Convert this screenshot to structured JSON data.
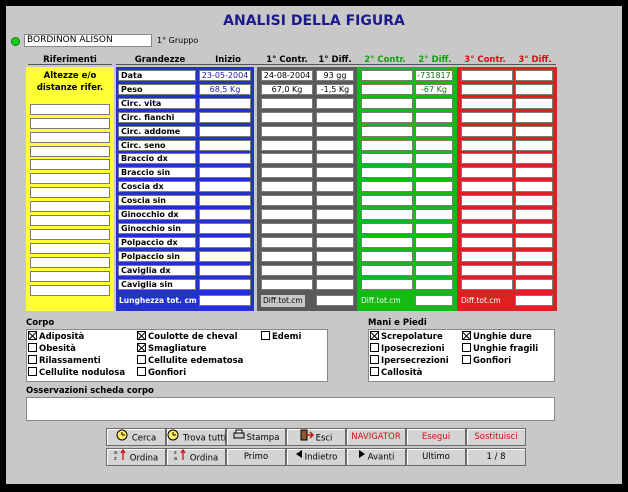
{
  "header": {
    "title": "ANALISI DELLA FIGURA",
    "patient_name": "BORDINON ALISON",
    "group": "1° Gruppo"
  },
  "columns": {
    "riferimenti": "Riferimenti",
    "grandezze": "Grandezze",
    "inizio": "Inizio",
    "contr1": "1° Contr.",
    "diff1": "1° Diff.",
    "contr2": "2° Contr.",
    "diff2": "2° Diff.",
    "contr3": "3° Contr.",
    "diff3": "3° Diff."
  },
  "riferimenti_label": "Altezze e/o distanze rifer.",
  "rows": [
    {
      "label": "Data",
      "inizio": "23-05-2004",
      "contr1": "24-08-2004",
      "diff1": "93 gg",
      "contr2": "",
      "diff2": "-731817",
      "contr3": "",
      "diff3": ""
    },
    {
      "label": "Peso",
      "inizio": "68,5 Kg",
      "contr1": "67,0 Kg",
      "diff1": "-1,5 Kg",
      "contr2": "",
      "diff2": "-67 Kg",
      "contr3": "",
      "diff3": ""
    },
    {
      "label": "Circ. vita"
    },
    {
      "label": "Circ. fianchi"
    },
    {
      "label": "Circ. addome"
    },
    {
      "label": "Circ. seno"
    },
    {
      "label": "Braccio dx"
    },
    {
      "label": "Braccio sin"
    },
    {
      "label": "Coscia dx"
    },
    {
      "label": "Coscia sin"
    },
    {
      "label": "Ginocchio dx"
    },
    {
      "label": "Ginocchio sin"
    },
    {
      "label": "Polpaccio dx"
    },
    {
      "label": "Polpaccio sin"
    },
    {
      "label": "Caviglia dx"
    },
    {
      "label": "Caviglia sin"
    }
  ],
  "totals": {
    "lunghezza": "Lunghezza tot. cm",
    "diff1": "Diff.tot.cm",
    "diff2": "Diff.tot.cm",
    "diff3": "Diff.tot.cm"
  },
  "corpo": {
    "label": "Corpo",
    "items": [
      {
        "label": "Adiposità",
        "checked": true
      },
      {
        "label": "Obesità",
        "checked": false
      },
      {
        "label": "Rilassamenti",
        "checked": false
      },
      {
        "label": "Cellulite nodulosa",
        "checked": false
      },
      {
        "label": "Coulotte de cheval",
        "checked": true
      },
      {
        "label": "Smagliature",
        "checked": true
      },
      {
        "label": "Cellulite edematosa",
        "checked": false
      },
      {
        "label": "Gonfiori",
        "checked": false
      },
      {
        "label": "Edemi",
        "checked": false
      }
    ]
  },
  "mani": {
    "label": "Mani e Piedi",
    "items": [
      {
        "label": "Screpolature",
        "checked": true
      },
      {
        "label": "Iposecrezioni",
        "checked": false
      },
      {
        "label": "Ipersecrezioni",
        "checked": false
      },
      {
        "label": "Callosità",
        "checked": false
      },
      {
        "label": "Unghie dure",
        "checked": true
      },
      {
        "label": "Unghie fragili",
        "checked": false
      },
      {
        "label": "Gonfiori",
        "checked": false
      }
    ]
  },
  "osservazioni": {
    "label": "Osservazioni scheda corpo",
    "value": ""
  },
  "toolbar": {
    "cerca": "Cerca",
    "trova_tutti": "Trova tutti",
    "stampa": "Stampa",
    "esci": "Esci",
    "navigator": "NAVIGATOR",
    "esegui": "Esegui",
    "sostituisci": "Sostituisci",
    "ordina_az": "Ordina",
    "ordina_za": "Ordina",
    "primo": "Primo",
    "indietro": "Indietro",
    "avanti": "Avanti",
    "ultimo": "Ultimo",
    "record": "1 / 8"
  },
  "colors": {
    "yellow": "#ffff33",
    "blue": "#2233cc",
    "green": "#11bb11",
    "red": "#e02020",
    "gray": "#5a5a5a"
  }
}
